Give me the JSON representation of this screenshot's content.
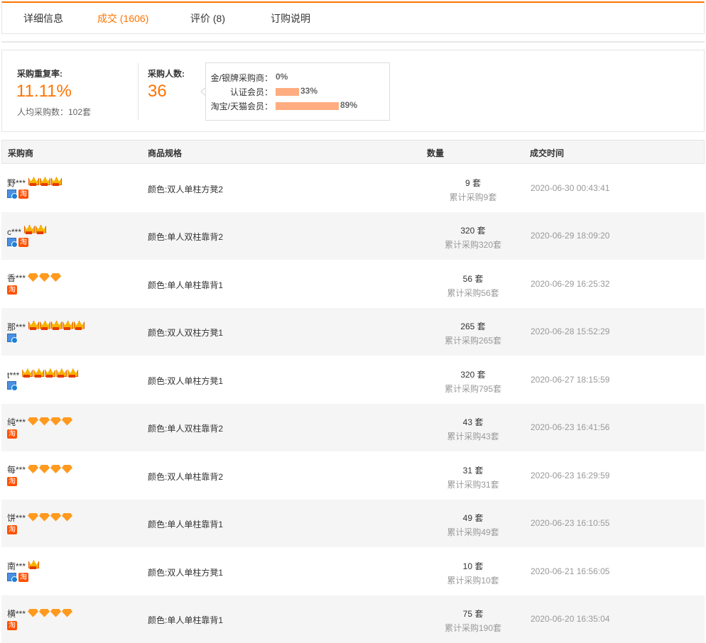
{
  "tabs": [
    {
      "label": "详细信息",
      "active": false
    },
    {
      "label": "成交 (1606)",
      "active": true
    },
    {
      "label": "评价 (8)",
      "active": false
    },
    {
      "label": "订购说明",
      "active": false
    }
  ],
  "accent_color": "#ff7300",
  "stats": {
    "repeat_rate_label": "采购重复率:",
    "repeat_rate_value": "11.11%",
    "avg_purchase": "人均采购数：102套",
    "buyer_count_label": "采购人数:",
    "buyer_count_value": "36",
    "distribution": [
      {
        "label": "金/银牌采购商：",
        "percent_text": "0%",
        "fraction": 0.0
      },
      {
        "label": "认证会员：",
        "percent_text": "33%",
        "fraction": 0.33
      },
      {
        "label": "淘宝/天猫会员：",
        "percent_text": "89%",
        "fraction": 0.89
      }
    ]
  },
  "table": {
    "headers": {
      "buyer": "采购商",
      "spec": "商品规格",
      "qty": "数量",
      "time": "成交时间"
    },
    "badge_tao_text": "淘",
    "rows": [
      {
        "buyer": "野***",
        "level_icon": "crown-icon",
        "level_count": 3,
        "badge_id": true,
        "badge_tao": true,
        "spec": "颜色:双人单柱方凳2",
        "qty": "9 套",
        "total": "累计采购9套",
        "time": "2020-06-30 00:43:41"
      },
      {
        "buyer": "c***",
        "level_icon": "crown-icon",
        "level_count": 2,
        "badge_id": true,
        "badge_tao": true,
        "spec": "颜色:单人双柱靠背2",
        "qty": "320 套",
        "total": "累计采购320套",
        "time": "2020-06-29 18:09:20"
      },
      {
        "buyer": "香***",
        "level_icon": "diamond-icon",
        "level_count": 3,
        "badge_id": false,
        "badge_tao": true,
        "spec": "颜色:单人单柱靠背1",
        "qty": "56 套",
        "total": "累计采购56套",
        "time": "2020-06-29 16:25:32"
      },
      {
        "buyer": "那***",
        "level_icon": "crown-icon",
        "level_count": 5,
        "badge_id": true,
        "badge_tao": false,
        "spec": "颜色:双人双柱方凳1",
        "qty": "265 套",
        "total": "累计采购265套",
        "time": "2020-06-28 15:52:29"
      },
      {
        "buyer": "t***",
        "level_icon": "crown-icon",
        "level_count": 5,
        "badge_id": true,
        "badge_tao": false,
        "spec": "颜色:双人单柱方凳1",
        "qty": "320 套",
        "total": "累计采购795套",
        "time": "2020-06-27 18:15:59"
      },
      {
        "buyer": "纯***",
        "level_icon": "diamond-icon",
        "level_count": 4,
        "badge_id": false,
        "badge_tao": true,
        "spec": "颜色:单人双柱靠背2",
        "qty": "43 套",
        "total": "累计采购43套",
        "time": "2020-06-23 16:41:56"
      },
      {
        "buyer": "每***",
        "level_icon": "diamond-icon",
        "level_count": 4,
        "badge_id": false,
        "badge_tao": true,
        "spec": "颜色:双人单柱靠背2",
        "qty": "31 套",
        "total": "累计采购31套",
        "time": "2020-06-23 16:29:59"
      },
      {
        "buyer": "饼***",
        "level_icon": "diamond-icon",
        "level_count": 4,
        "badge_id": false,
        "badge_tao": true,
        "spec": "颜色:单人单柱靠背1",
        "qty": "49 套",
        "total": "累计采购49套",
        "time": "2020-06-23 16:10:55"
      },
      {
        "buyer": "南***",
        "level_icon": "crown-icon",
        "level_count": 1,
        "badge_id": true,
        "badge_tao": true,
        "spec": "颜色:双人单柱方凳1",
        "qty": "10 套",
        "total": "累计采购10套",
        "time": "2020-06-21 16:56:05"
      },
      {
        "buyer": "横***",
        "level_icon": "diamond-icon",
        "level_count": 4,
        "badge_id": false,
        "badge_tao": true,
        "spec": "颜色:单人单柱靠背1",
        "qty": "75 套",
        "total": "累计采购190套",
        "time": "2020-06-20 16:35:04"
      }
    ]
  }
}
